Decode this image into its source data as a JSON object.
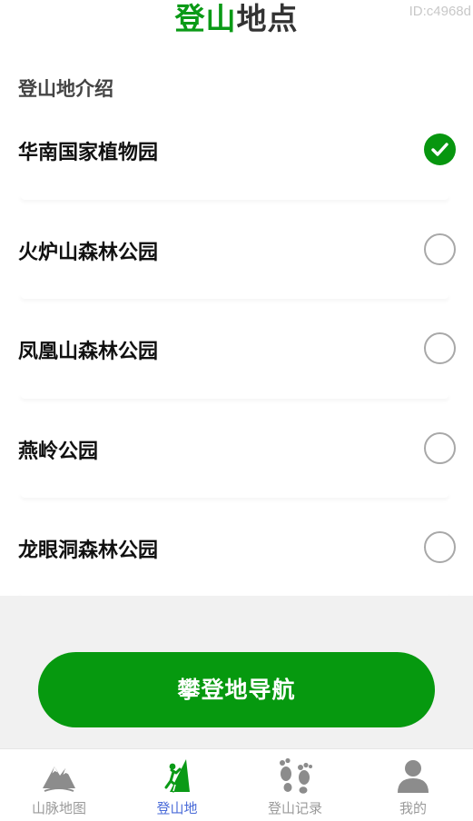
{
  "header": {
    "title_green": "登山",
    "title_dark": "地点",
    "watermark": "ID:c4968d"
  },
  "section_title": "登山地介绍",
  "locations": [
    {
      "name": "华南国家植物园",
      "selected": true
    },
    {
      "name": "火炉山森林公园",
      "selected": false
    },
    {
      "name": "凤凰山森林公园",
      "selected": false
    },
    {
      "name": "燕岭公园",
      "selected": false
    },
    {
      "name": "龙眼洞森林公园",
      "selected": false
    }
  ],
  "nav_button": "攀登地导航",
  "tabs": [
    {
      "label": "山脉地图",
      "icon": "mountain-icon",
      "active": false
    },
    {
      "label": "登山地",
      "icon": "climber-icon",
      "active": true
    },
    {
      "label": "登山记录",
      "icon": "footprints-icon",
      "active": false
    },
    {
      "label": "我的",
      "icon": "user-icon",
      "active": false
    }
  ],
  "colors": {
    "brand_green": "#07960f",
    "tab_active": "#4a6bd8",
    "tab_inactive": "#9a9a9a"
  }
}
